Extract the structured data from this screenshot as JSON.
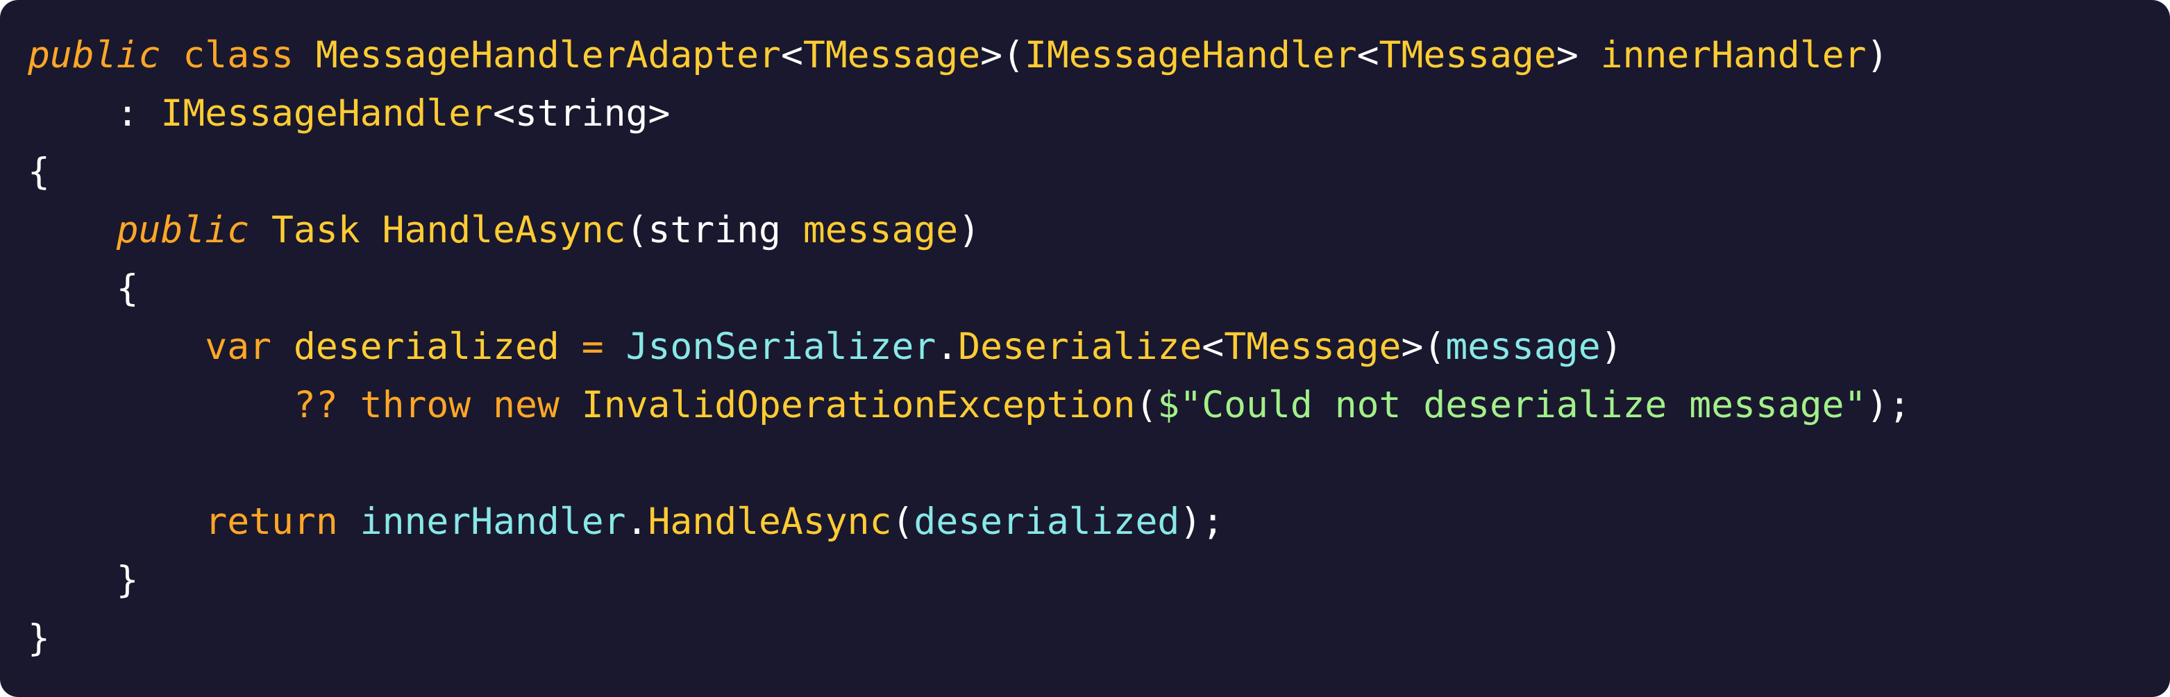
{
  "colors": {
    "background": "#1a182e",
    "keyword": "#ffa726",
    "type": "#ffcc33",
    "identifier": "#88e8e8",
    "string": "#a2f08a",
    "plain": "#ffffff"
  },
  "code": {
    "lines": [
      {
        "tokens": [
          {
            "text": "public",
            "kind": "kw-it"
          },
          {
            "text": " ",
            "kind": "plain"
          },
          {
            "text": "class",
            "kind": "kw"
          },
          {
            "text": " ",
            "kind": "plain"
          },
          {
            "text": "MessageHandlerAdapter",
            "kind": "type"
          },
          {
            "text": "<",
            "kind": "plain"
          },
          {
            "text": "TMessage",
            "kind": "type"
          },
          {
            "text": ">(",
            "kind": "plain"
          },
          {
            "text": "IMessageHandler",
            "kind": "type"
          },
          {
            "text": "<",
            "kind": "plain"
          },
          {
            "text": "TMessage",
            "kind": "type"
          },
          {
            "text": "> ",
            "kind": "plain"
          },
          {
            "text": "innerHandler",
            "kind": "type"
          },
          {
            "text": ")",
            "kind": "plain"
          }
        ]
      },
      {
        "tokens": [
          {
            "text": "    : ",
            "kind": "plain"
          },
          {
            "text": "IMessageHandler",
            "kind": "type"
          },
          {
            "text": "<string>",
            "kind": "plain"
          }
        ]
      },
      {
        "tokens": [
          {
            "text": "{",
            "kind": "plain"
          }
        ]
      },
      {
        "tokens": [
          {
            "text": "    ",
            "kind": "plain"
          },
          {
            "text": "public",
            "kind": "kw-it"
          },
          {
            "text": " ",
            "kind": "plain"
          },
          {
            "text": "Task",
            "kind": "type"
          },
          {
            "text": " ",
            "kind": "plain"
          },
          {
            "text": "HandleAsync",
            "kind": "type"
          },
          {
            "text": "(string ",
            "kind": "plain"
          },
          {
            "text": "message",
            "kind": "type"
          },
          {
            "text": ")",
            "kind": "plain"
          }
        ]
      },
      {
        "tokens": [
          {
            "text": "    {",
            "kind": "plain"
          }
        ]
      },
      {
        "tokens": [
          {
            "text": "        ",
            "kind": "plain"
          },
          {
            "text": "var",
            "kind": "kw"
          },
          {
            "text": " ",
            "kind": "plain"
          },
          {
            "text": "deserialized",
            "kind": "type"
          },
          {
            "text": " ",
            "kind": "plain"
          },
          {
            "text": "=",
            "kind": "kw"
          },
          {
            "text": " ",
            "kind": "plain"
          },
          {
            "text": "JsonSerializer",
            "kind": "id"
          },
          {
            "text": ".",
            "kind": "plain"
          },
          {
            "text": "Deserialize",
            "kind": "type"
          },
          {
            "text": "<",
            "kind": "plain"
          },
          {
            "text": "TMessage",
            "kind": "type"
          },
          {
            "text": ">(",
            "kind": "plain"
          },
          {
            "text": "message",
            "kind": "id"
          },
          {
            "text": ")",
            "kind": "plain"
          }
        ]
      },
      {
        "tokens": [
          {
            "text": "            ",
            "kind": "plain"
          },
          {
            "text": "??",
            "kind": "kw"
          },
          {
            "text": " ",
            "kind": "plain"
          },
          {
            "text": "throw",
            "kind": "kw"
          },
          {
            "text": " ",
            "kind": "plain"
          },
          {
            "text": "new",
            "kind": "kw"
          },
          {
            "text": " ",
            "kind": "plain"
          },
          {
            "text": "InvalidOperationException",
            "kind": "type"
          },
          {
            "text": "(",
            "kind": "plain"
          },
          {
            "text": "$\"Could not deserialize message\"",
            "kind": "str"
          },
          {
            "text": ");",
            "kind": "plain"
          }
        ]
      },
      {
        "tokens": []
      },
      {
        "tokens": [
          {
            "text": "        ",
            "kind": "plain"
          },
          {
            "text": "return",
            "kind": "kw"
          },
          {
            "text": " ",
            "kind": "plain"
          },
          {
            "text": "innerHandler",
            "kind": "id"
          },
          {
            "text": ".",
            "kind": "plain"
          },
          {
            "text": "HandleAsync",
            "kind": "type"
          },
          {
            "text": "(",
            "kind": "plain"
          },
          {
            "text": "deserialized",
            "kind": "id"
          },
          {
            "text": ");",
            "kind": "plain"
          }
        ]
      },
      {
        "tokens": [
          {
            "text": "    }",
            "kind": "plain"
          }
        ]
      },
      {
        "tokens": [
          {
            "text": "}",
            "kind": "plain"
          }
        ]
      }
    ]
  }
}
